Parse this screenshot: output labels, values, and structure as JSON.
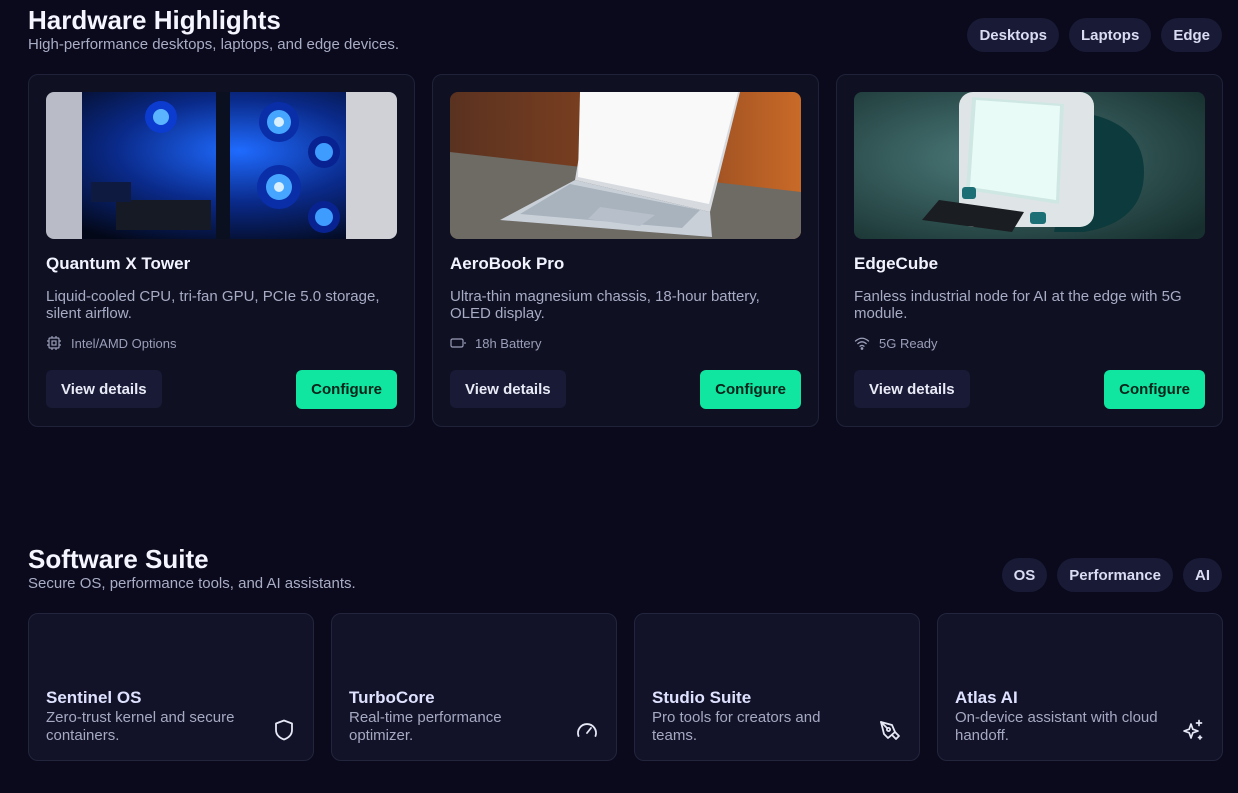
{
  "hardware": {
    "title": "Hardware Highlights",
    "subtitle": "High-performance desktops, laptops, and edge devices.",
    "filters": [
      "Desktops",
      "Laptops",
      "Edge"
    ],
    "cards": [
      {
        "name": "Quantum X Tower",
        "description": "Liquid-cooled CPU, tri-fan GPU, PCIe 5.0 storage, silent airflow.",
        "spec": "Intel/AMD Options",
        "spec_icon": "cpu-icon",
        "details_label": "View details",
        "configure_label": "Configure"
      },
      {
        "name": "AeroBook Pro",
        "description": "Ultra-thin magnesium chassis, 18-hour battery, OLED display.",
        "spec": "18h Battery",
        "spec_icon": "battery-icon",
        "details_label": "View details",
        "configure_label": "Configure"
      },
      {
        "name": "EdgeCube",
        "description": "Fanless industrial node for AI at the edge with 5G module.",
        "spec": "5G Ready",
        "spec_icon": "wifi-icon",
        "details_label": "View details",
        "configure_label": "Configure"
      }
    ]
  },
  "software": {
    "title": "Software Suite",
    "subtitle": "Secure OS, performance tools, and AI assistants.",
    "filters": [
      "OS",
      "Performance",
      "AI"
    ],
    "cards": [
      {
        "name": "Sentinel OS",
        "description": "Zero-trust kernel and secure containers.",
        "icon": "shield-icon"
      },
      {
        "name": "TurboCore",
        "description": "Real-time performance optimizer.",
        "icon": "gauge-icon"
      },
      {
        "name": "Studio Suite",
        "description": "Pro tools for creators and teams.",
        "icon": "pen-tool-icon"
      },
      {
        "name": "Atlas AI",
        "description": "On-device assistant with cloud handoff.",
        "icon": "sparkles-icon"
      }
    ]
  },
  "colors": {
    "background": "#0a0a1c",
    "accent": "#10e6a0",
    "card": "#0f1123",
    "pill": "#191a36"
  }
}
